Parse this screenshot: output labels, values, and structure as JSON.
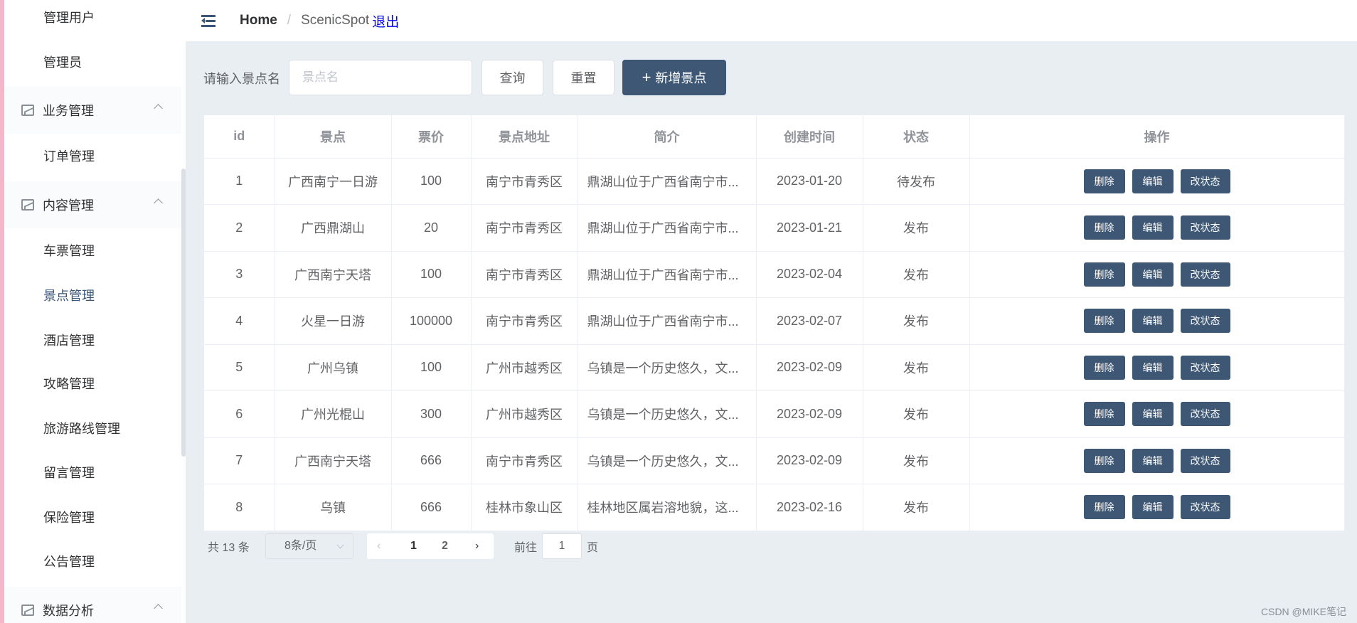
{
  "sidebar": {
    "items_top": [
      "管理用户",
      "管理员"
    ],
    "group_business": "业务管理",
    "business_items": [
      "订单管理"
    ],
    "group_content": "内容管理",
    "content_items": [
      "车票管理",
      "景点管理",
      "酒店管理",
      "攻略管理",
      "旅游路线管理",
      "留言管理",
      "保险管理",
      "公告管理"
    ],
    "group_data": "数据分析"
  },
  "header": {
    "home": "Home",
    "separator": "/",
    "current": "ScenicSpot",
    "logout": "退出"
  },
  "search": {
    "label": "请输入景点名",
    "placeholder": "景点名",
    "query_label": "查询",
    "reset_label": "重置",
    "add_label": "新增景点"
  },
  "table": {
    "columns": [
      "id",
      "景点",
      "票价",
      "景点地址",
      "简介",
      "创建时间",
      "状态",
      "操作"
    ],
    "action_labels": [
      "删除",
      "编辑",
      "改状态"
    ],
    "rows": [
      [
        "1",
        "广西南宁一日游",
        "100",
        "南宁市青秀区",
        "鼎湖山位于广西省南宁市...",
        "2023-01-20",
        "待发布"
      ],
      [
        "2",
        "广西鼎湖山",
        "20",
        "南宁市青秀区",
        "鼎湖山位于广西省南宁市...",
        "2023-01-21",
        "发布"
      ],
      [
        "3",
        "广西南宁天塔",
        "100",
        "南宁市青秀区",
        "鼎湖山位于广西省南宁市...",
        "2023-02-04",
        "发布"
      ],
      [
        "4",
        "火星一日游",
        "100000",
        "南宁市青秀区",
        "鼎湖山位于广西省南宁市...",
        "2023-02-07",
        "发布"
      ],
      [
        "5",
        "广州乌镇",
        "100",
        "广州市越秀区",
        "乌镇是一个历史悠久，文...",
        "2023-02-09",
        "发布"
      ],
      [
        "6",
        "广州光棍山",
        "300",
        "广州市越秀区",
        "乌镇是一个历史悠久，文...",
        "2023-02-09",
        "发布"
      ],
      [
        "7",
        "广西南宁天塔",
        "666",
        "南宁市青秀区",
        "乌镇是一个历史悠久，文...",
        "2023-02-09",
        "发布"
      ],
      [
        "8",
        "乌镇",
        "666",
        "桂林市象山区",
        "桂林地区属岩溶地貌，这...",
        "2023-02-16",
        "发布"
      ]
    ]
  },
  "pagination": {
    "total": "共 13 条",
    "page_size": "8条/页",
    "pages": [
      "1",
      "2"
    ],
    "current_page": "1",
    "goto_label": "前往",
    "goto_value": "1",
    "page_suffix": "页"
  },
  "watermark": "CSDN @MIKE笔记",
  "colors": {
    "accent": "#3d5775",
    "sidebar_active": "#3a5778",
    "background": "#e9eef3"
  }
}
